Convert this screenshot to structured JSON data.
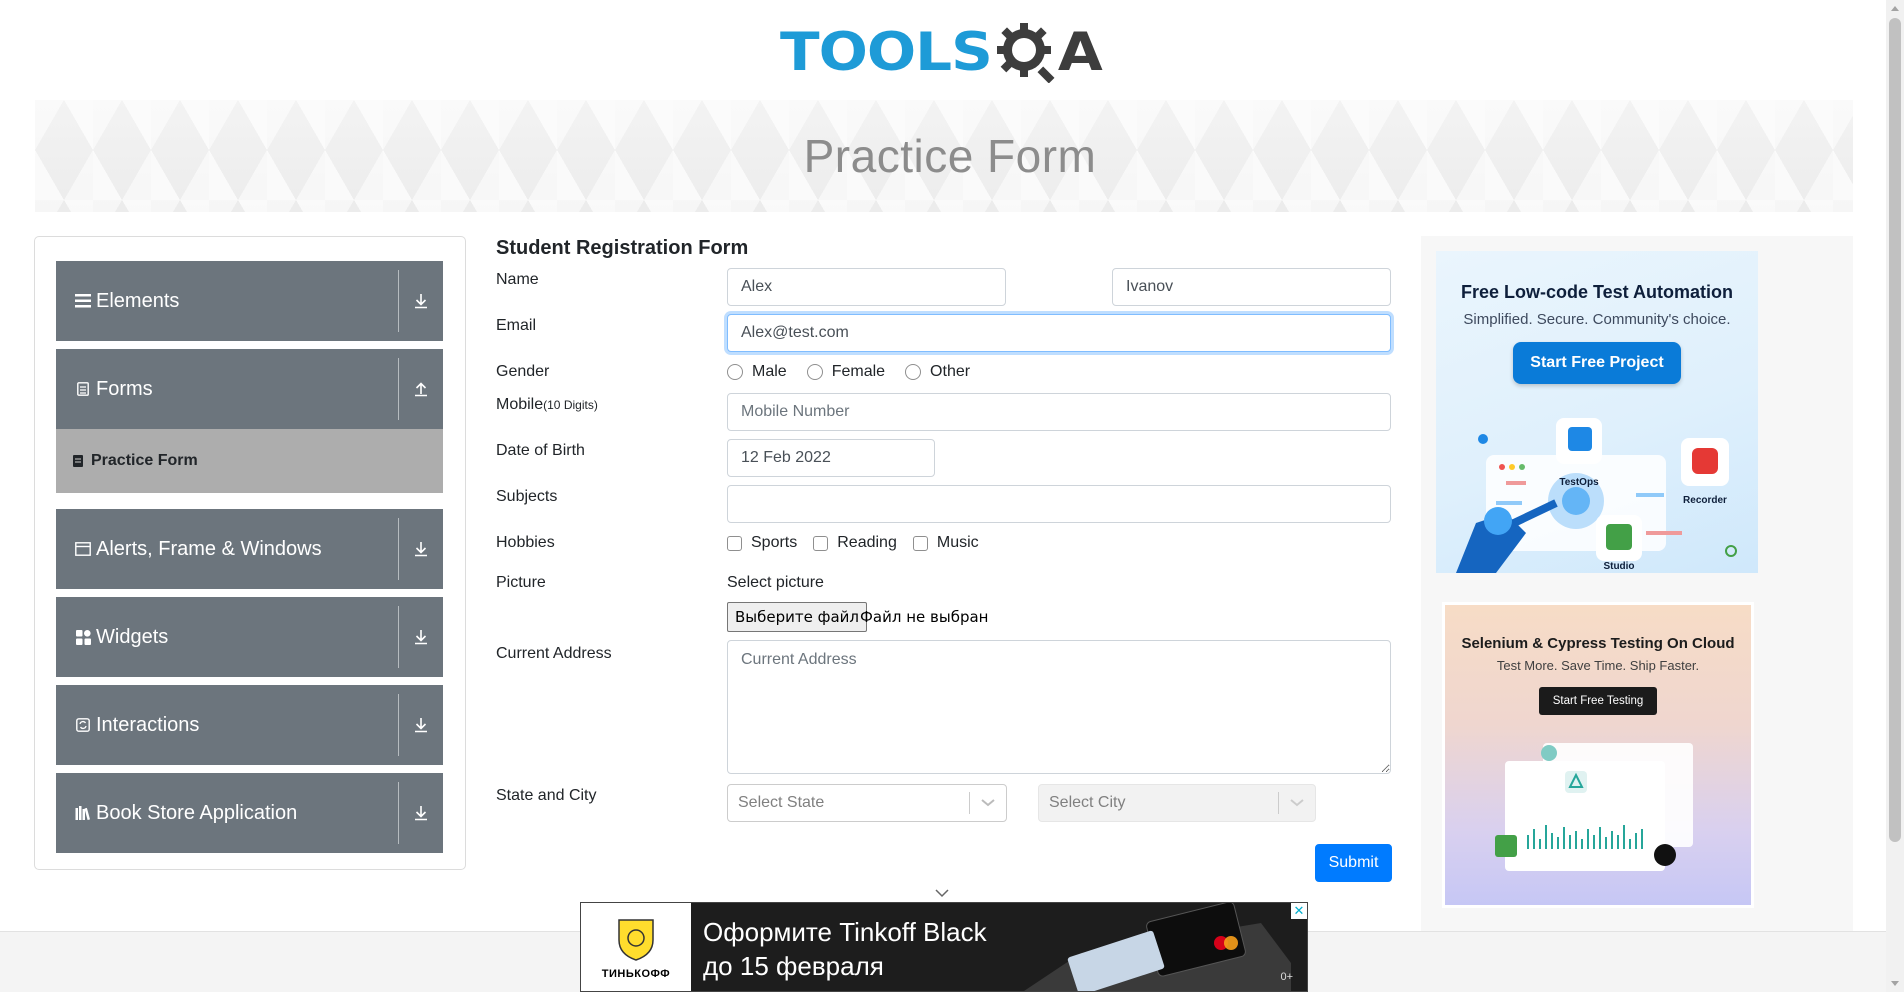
{
  "header": {
    "logo_text_left": "TOOLS",
    "logo_text_right": "A",
    "page_title": "Practice Form"
  },
  "sidebar": {
    "groups": [
      {
        "label": "Elements",
        "icon": "list-icon",
        "arrow": "download-arrow-icon"
      },
      {
        "label": "Forms",
        "icon": "document-icon",
        "arrow": "upload-arrow-icon",
        "expanded": true
      },
      {
        "label": "Alerts, Frame & Windows",
        "icon": "window-icon",
        "arrow": "download-arrow-icon"
      },
      {
        "label": "Widgets",
        "icon": "grid-icon",
        "arrow": "download-arrow-icon"
      },
      {
        "label": "Interactions",
        "icon": "interaction-icon",
        "arrow": "download-arrow-icon"
      },
      {
        "label": "Book Store Application",
        "icon": "books-icon",
        "arrow": "download-arrow-icon"
      }
    ],
    "active_item": "Practice Form"
  },
  "form": {
    "title": "Student Registration Form",
    "name_label": "Name",
    "first_name_value": "Alex",
    "last_name_value": "Ivanov",
    "email_label": "Email",
    "email_value": "Alex@test.com",
    "gender_label": "Gender",
    "gender_options": [
      "Male",
      "Female",
      "Other"
    ],
    "mobile_label": "Mobile",
    "mobile_hint": "(10 Digits)",
    "mobile_placeholder": "Mobile Number",
    "dob_label": "Date of Birth",
    "dob_value": "12 Feb 2022",
    "subjects_label": "Subjects",
    "subjects_value": "",
    "hobbies_label": "Hobbies",
    "hobby_options": [
      "Sports",
      "Reading",
      "Music"
    ],
    "picture_label": "Picture",
    "picture_caption": "Select picture",
    "file_button": "Выберите файл",
    "file_status": "Файл не выбран",
    "address_label": "Current Address",
    "address_placeholder": "Current Address",
    "state_city_label": "State and City",
    "state_placeholder": "Select State",
    "city_placeholder": "Select City",
    "submit_label": "Submit"
  },
  "ads": {
    "ad1": {
      "title": "Free Low-code Test Automation",
      "subtitle": "Simplified. Secure. Community's choice.",
      "cta": "Start Free Project",
      "labels": [
        "TestOps",
        "Recorder",
        "Studio"
      ]
    },
    "ad2": {
      "title": "Selenium & Cypress Testing On Cloud",
      "subtitle": "Test More. Save Time. Ship Faster.",
      "cta": "Start Free Testing"
    },
    "bottom": {
      "bank": "ТИНЬКОФФ",
      "line1": "Оформите Tinkoff Black",
      "line2": "до 15 февраля",
      "age": "0+",
      "close": "✕"
    }
  },
  "colors": {
    "logo_blue": "#1e9bd7",
    "sidebar_group": "#6c757d",
    "active_item": "#adadad",
    "primary": "#007bff"
  }
}
